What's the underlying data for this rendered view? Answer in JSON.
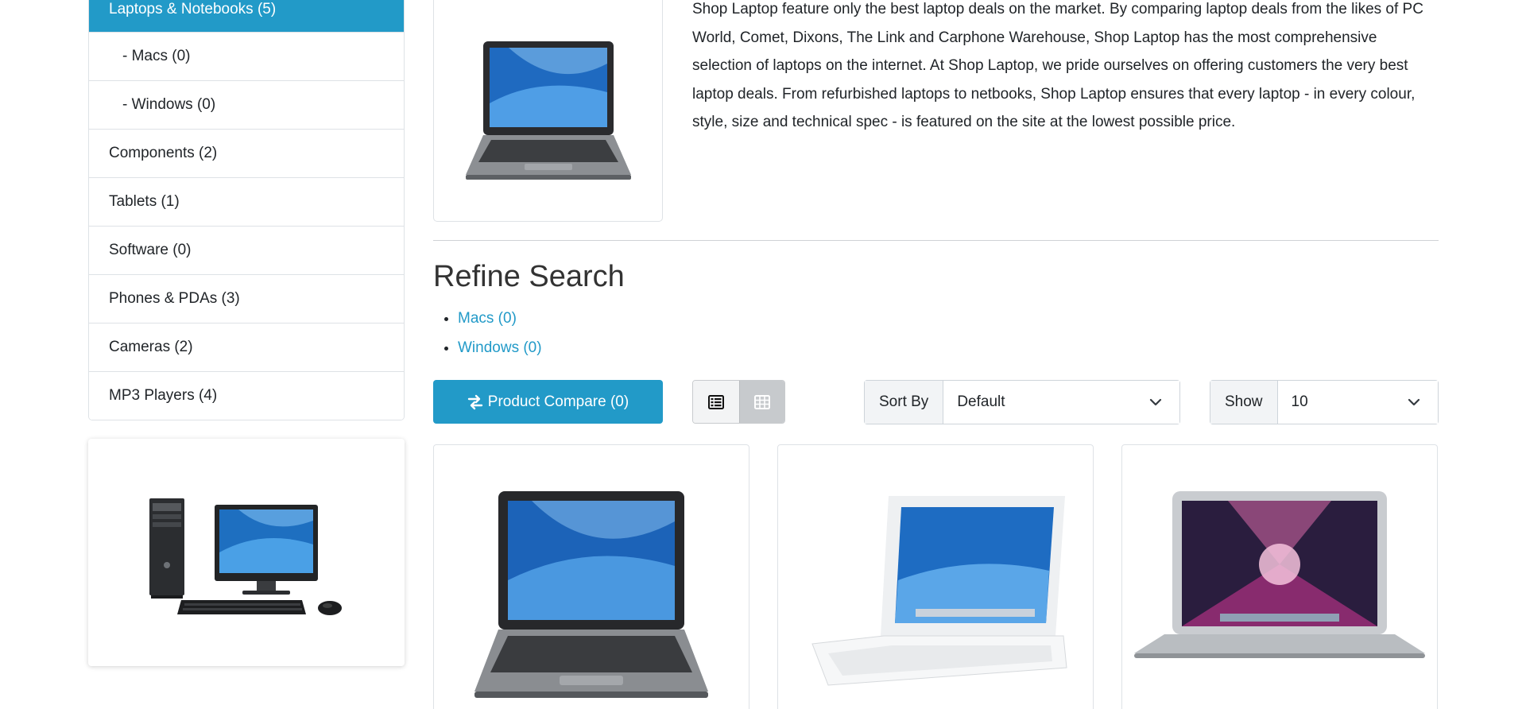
{
  "sidebar": {
    "categories": [
      {
        "label": "Laptops & Notebooks (5)",
        "active": true
      },
      {
        "label": "- Macs (0)"
      },
      {
        "label": "- Windows (0)"
      },
      {
        "label": "Components (2)"
      },
      {
        "label": "Tablets (1)"
      },
      {
        "label": "Software (0)"
      },
      {
        "label": "Phones & PDAs (3)"
      },
      {
        "label": "Cameras (2)"
      },
      {
        "label": "MP3 Players (4)"
      }
    ]
  },
  "category": {
    "description": "Shop Laptop feature only the best laptop deals on the market. By comparing laptop deals from the likes of PC World, Comet, Dixons, The Link and Carphone Warehouse, Shop Laptop has the most comprehensive selection of laptops on the internet. At Shop Laptop, we pride ourselves on offering customers the very best laptop deals. From refurbished laptops to netbooks, Shop Laptop ensures that every laptop - in every colour, style, size and technical spec - is featured on the site at the lowest possible price."
  },
  "refine": {
    "title": "Refine Search",
    "links": [
      "Macs (0)",
      "Windows (0)"
    ]
  },
  "toolbar": {
    "compare_label": "Product Compare (0)",
    "sort_label": "Sort By",
    "sort_value": "Default",
    "show_label": "Show",
    "show_value": "10"
  },
  "icons": {
    "compare": "arrows-exchange-icon",
    "list_view": "list-view-icon",
    "grid_view": "grid-view-icon",
    "dropdown": "chevron-down-icon"
  },
  "colors": {
    "accent": "#229ac8",
    "border": "#dee2e6"
  }
}
